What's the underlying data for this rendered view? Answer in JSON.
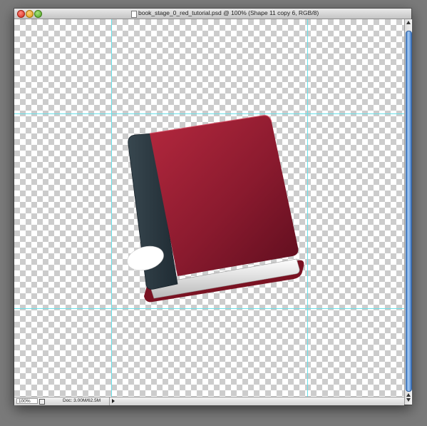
{
  "window": {
    "title": "book_stage_0_red_tutorial.psd @ 100% (Shape 11 copy 6, RGB/8)"
  },
  "statusbar": {
    "zoom": "100%",
    "doc_info": "Doc: 3.00M/62.5M"
  },
  "colors": {
    "cover": "#8e1c30",
    "spine": "#2b3a44",
    "guide": "#69e0e8",
    "scroll_thumb": "#4b86cf"
  },
  "icons": [
    "close-icon",
    "minimize-icon",
    "zoom-icon",
    "document-icon",
    "status-menu-arrow-icon"
  ]
}
